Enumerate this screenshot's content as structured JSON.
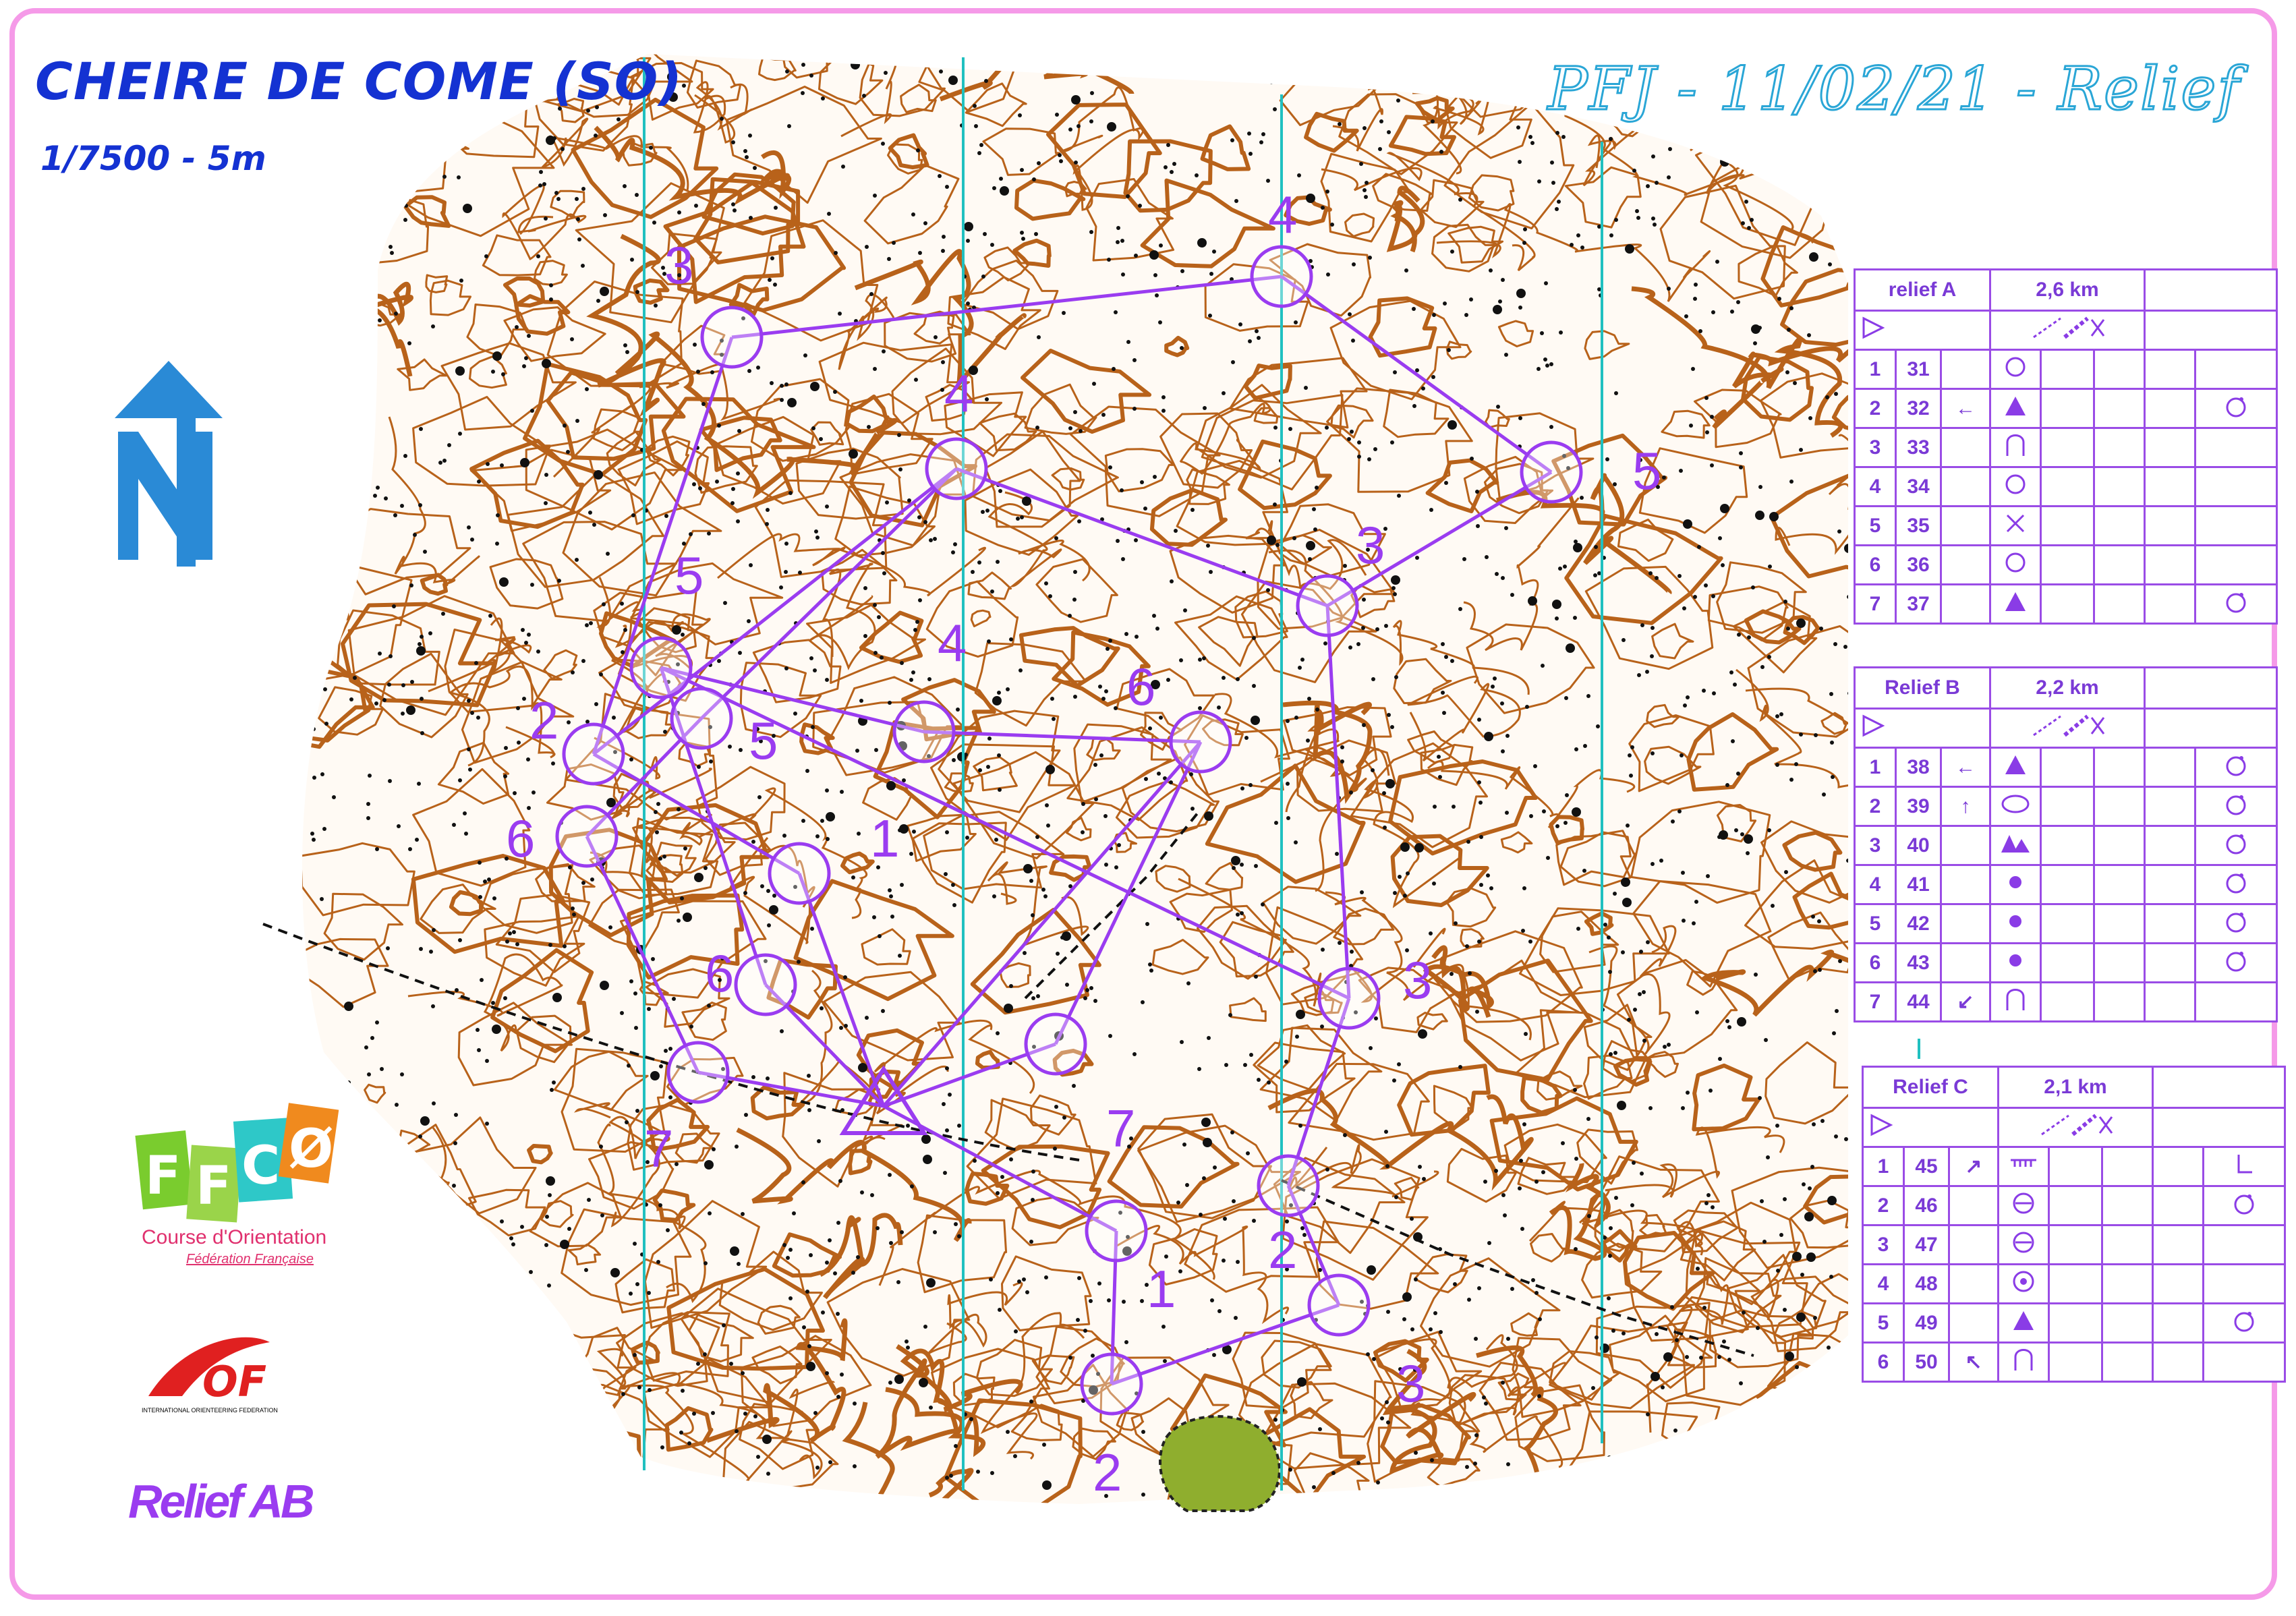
{
  "map": {
    "title": "CHEIRE DE COME (SO)",
    "scale_label": "1/7500 - 5m",
    "event_title": "PFJ - 11/02/21 - Relief",
    "ffco_line1": "Course d'Orientation",
    "ffco_line2": "Fédération Française",
    "ffco_letters": "FFCO",
    "iof_letters": "IOF",
    "iof_line": "INTERNATIONAL ORIENTEERING FEDERATION",
    "sheet_label": "Relief AB",
    "colors": {
      "course": "#9a3cf0",
      "contour": "#b8621a",
      "grid": "#20c0c0",
      "frame": "#f59ae8",
      "title": "#1432d2"
    }
  },
  "control_numbers": [
    "1",
    "2",
    "3",
    "4",
    "5",
    "6",
    "7"
  ],
  "courses": [
    {
      "name": "relief A",
      "length": "2,6 km",
      "controls": [
        {
          "n": "1",
          "code": "31",
          "dir": "",
          "feature": "circle",
          "detail": ""
        },
        {
          "n": "2",
          "code": "32",
          "dir": "←",
          "feature": "triangle",
          "detail": "circle-dot"
        },
        {
          "n": "3",
          "code": "33",
          "dir": "",
          "feature": "spur",
          "detail": ""
        },
        {
          "n": "4",
          "code": "34",
          "dir": "",
          "feature": "circle",
          "detail": ""
        },
        {
          "n": "5",
          "code": "35",
          "dir": "",
          "feature": "cross",
          "detail": ""
        },
        {
          "n": "6",
          "code": "36",
          "dir": "",
          "feature": "circle",
          "detail": ""
        },
        {
          "n": "7",
          "code": "37",
          "dir": "",
          "feature": "triangle",
          "detail": "circle-dot"
        }
      ]
    },
    {
      "name": "Relief B",
      "length": "2,2 km",
      "controls": [
        {
          "n": "1",
          "code": "38",
          "dir": "←",
          "feature": "triangle",
          "detail": "circle-dot"
        },
        {
          "n": "2",
          "code": "39",
          "dir": "↑",
          "feature": "ellipse",
          "detail": "circle-dot"
        },
        {
          "n": "3",
          "code": "40",
          "dir": "",
          "feature": "triangles",
          "detail": "circle-dot"
        },
        {
          "n": "4",
          "code": "41",
          "dir": "",
          "feature": "dot",
          "detail": "circle-dot"
        },
        {
          "n": "5",
          "code": "42",
          "dir": "",
          "feature": "dot",
          "detail": "circle-dot"
        },
        {
          "n": "6",
          "code": "43",
          "dir": "",
          "feature": "dot",
          "detail": "circle-dot"
        },
        {
          "n": "7",
          "code": "44",
          "dir": "↙",
          "feature": "spur",
          "detail": ""
        }
      ]
    },
    {
      "name": "Relief C",
      "length": "2,1 km",
      "controls": [
        {
          "n": "1",
          "code": "45",
          "dir": "↗",
          "feature": "cliff",
          "detail": "corner"
        },
        {
          "n": "2",
          "code": "46",
          "dir": "",
          "feature": "knoll",
          "detail": "circle-dot"
        },
        {
          "n": "3",
          "code": "47",
          "dir": "",
          "feature": "knoll",
          "detail": ""
        },
        {
          "n": "4",
          "code": "48",
          "dir": "",
          "feature": "target",
          "detail": ""
        },
        {
          "n": "5",
          "code": "49",
          "dir": "",
          "feature": "triangle",
          "detail": "circle-dot"
        },
        {
          "n": "6",
          "code": "50",
          "dir": "↖",
          "feature": "spur",
          "detail": ""
        }
      ]
    }
  ]
}
